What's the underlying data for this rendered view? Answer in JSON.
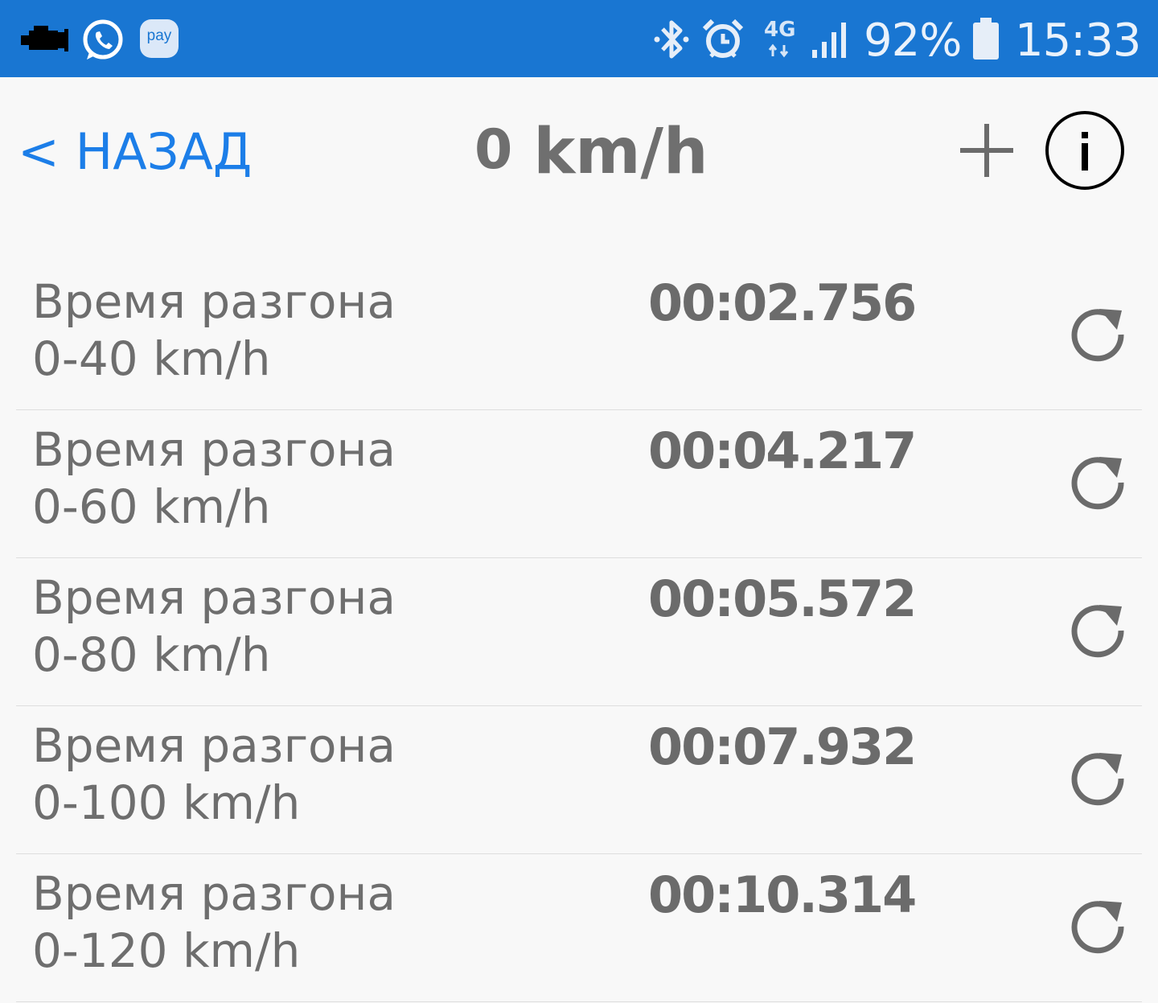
{
  "status_bar": {
    "left_icons": [
      "check-engine-icon",
      "whatsapp-icon",
      "pay-icon"
    ],
    "pay_label": "pay",
    "right_icons": [
      "bluetooth-icon",
      "alarm-icon",
      "network-4g-icon",
      "signal-icon",
      "battery-icon"
    ],
    "network_label": "4G",
    "battery_percent": "92%",
    "time": "15:33",
    "background_color": "#1976d2"
  },
  "header": {
    "back_label": "< НАЗАД",
    "speed_value": "0",
    "speed_unit": "km/h",
    "add_icon": "plus-icon",
    "info_icon": "info-icon",
    "back_color": "#1c7ee8"
  },
  "results": [
    {
      "title": "Время разгона",
      "range": "0-40 km/h",
      "time": "00:02.756"
    },
    {
      "title": "Время разгона",
      "range": "0-60 km/h",
      "time": "00:04.217"
    },
    {
      "title": "Время разгона",
      "range": "0-80 km/h",
      "time": "00:05.572"
    },
    {
      "title": "Время разгона",
      "range": "0-100 km/h",
      "time": "00:07.932"
    },
    {
      "title": "Время разгона",
      "range": "0-120 km/h",
      "time": "00:10.314"
    }
  ],
  "row_action_icon": "refresh-icon"
}
